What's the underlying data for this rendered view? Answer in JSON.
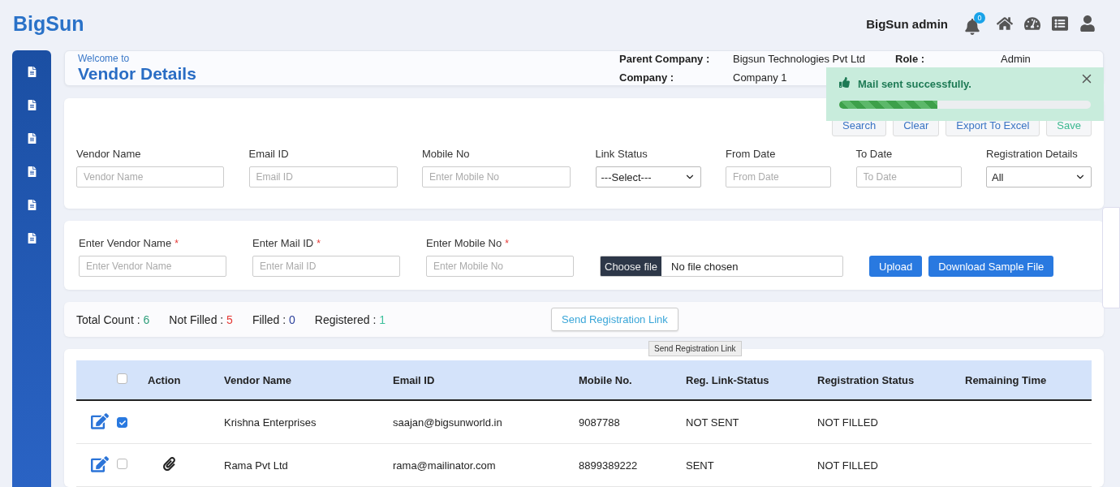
{
  "brand": "BigSun",
  "topbar": {
    "user": "BigSun admin",
    "notification_count": "0"
  },
  "sidebar": {
    "items": [
      {
        "selected": false
      },
      {
        "selected": false
      },
      {
        "selected": false
      },
      {
        "selected": false
      },
      {
        "selected": false
      },
      {
        "selected": false
      }
    ]
  },
  "header": {
    "welcome": "Welcome to",
    "title": "Vendor Details",
    "info": [
      {
        "label": "Parent Company :",
        "value": "Bigsun Technologies Pvt Ltd"
      },
      {
        "label": "Company :",
        "value": "Company 1"
      }
    ],
    "role_label": "Role :",
    "role_value": "Admin"
  },
  "toast": {
    "message": "Mail sent successfully.",
    "level": 0.39
  },
  "actions": [
    {
      "label": "Search",
      "kind": "primary"
    },
    {
      "label": "Clear",
      "kind": "primary"
    },
    {
      "label": "Export To Excel",
      "kind": "primary"
    },
    {
      "label": "Save",
      "kind": "success"
    }
  ],
  "filters": [
    {
      "label": "Vendor Name",
      "kind": "text",
      "placeholder": "Vendor Name"
    },
    {
      "label": "Email ID",
      "kind": "text",
      "placeholder": "Email ID"
    },
    {
      "label": "Mobile No",
      "kind": "text",
      "placeholder": "Enter Mobile No"
    },
    {
      "label": "Link Status",
      "kind": "select",
      "value": "---Select---"
    },
    {
      "label": "From Date",
      "kind": "text",
      "placeholder": "From Date"
    },
    {
      "label": "To Date",
      "kind": "text",
      "placeholder": "To Date"
    },
    {
      "label": "Registration Details",
      "kind": "select",
      "value": "All"
    }
  ],
  "upload": {
    "fields": [
      {
        "label": "Enter Vendor Name",
        "required": "*",
        "placeholder": "Enter Vendor Name"
      },
      {
        "label": "Enter Mail ID",
        "required": "*",
        "placeholder": "Enter Mail ID"
      },
      {
        "label": "Enter Mobile No",
        "required": "*",
        "placeholder": "Enter Mobile No"
      }
    ],
    "file_button": "Choose file",
    "file_status": "No file chosen",
    "buttons": [
      "Upload",
      "Download Sample File"
    ]
  },
  "stats": [
    {
      "label": "Total Count :",
      "value": "6",
      "color": "#2e9e7a"
    },
    {
      "label": "Not Filled :",
      "value": "5",
      "color": "#e53935"
    },
    {
      "label": "Filled :",
      "value": "0",
      "color": "#2a3f9b"
    },
    {
      "label": "Registered :",
      "value": "1",
      "color": "#3bbf9b"
    }
  ],
  "send_button": "Send Registration Link",
  "tooltip": "Send Registration Link",
  "table": {
    "header_checked": false,
    "columns": [
      "Action",
      "Vendor Name",
      "Email ID",
      "Mobile No.",
      "Reg. Link-Status",
      "Registration Status",
      "Remaining Time"
    ],
    "rows": [
      {
        "checked": true,
        "attachment": false,
        "cells": [
          "",
          "Krishna Enterprises",
          "saajan@bigsunworld.in",
          "9087788",
          "NOT SENT",
          "NOT FILLED"
        ]
      },
      {
        "checked": false,
        "attachment": true,
        "cells": [
          "",
          "Rama Pvt Ltd",
          "rama@mailinator.com",
          "8899389222",
          "SENT",
          "NOT FILLED"
        ]
      }
    ]
  }
}
